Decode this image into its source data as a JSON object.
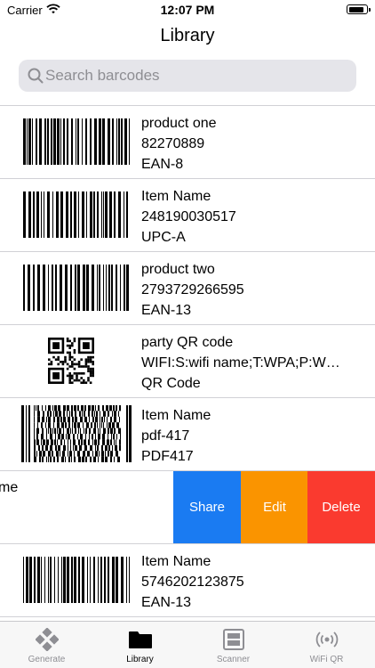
{
  "status_bar": {
    "carrier": "Carrier",
    "time": "12:07 PM",
    "battery_level": 0.9
  },
  "nav": {
    "title": "Library"
  },
  "search": {
    "placeholder": "Search barcodes",
    "value": ""
  },
  "items": [
    {
      "title": "product one",
      "value": "82270889",
      "type": "EAN-8",
      "thumb": "linear-barcode"
    },
    {
      "title": "Item Name",
      "value": "248190030517",
      "type": "UPC-A",
      "thumb": "linear-barcode"
    },
    {
      "title": "product two",
      "value": "2793729266595",
      "type": "EAN-13",
      "thumb": "linear-barcode"
    },
    {
      "title": "party QR code",
      "value": "WIFI:S:wifi name;T:WPA;P:W…",
      "type": "QR Code",
      "thumb": "qr-code"
    },
    {
      "title": "Item Name",
      "value": "pdf-417",
      "type": "PDF417",
      "thumb": "pdf417-code"
    }
  ],
  "swiped_row": {
    "partial_title": "me",
    "actions": {
      "share": "Share",
      "edit": "Edit",
      "delete": "Delete"
    },
    "colors": {
      "share": "#1a7bf2",
      "edit": "#fa9400",
      "delete": "#fa3a2f"
    }
  },
  "items_after": [
    {
      "title": "Item Name",
      "value": "5746202123875",
      "type": "EAN-13",
      "thumb": "linear-barcode"
    }
  ],
  "tabs": [
    {
      "label": "Generate",
      "icon": "generate-icon",
      "active": false
    },
    {
      "label": "Library",
      "icon": "folder-icon",
      "active": true
    },
    {
      "label": "Scanner",
      "icon": "scanner-icon",
      "active": false
    },
    {
      "label": "WiFi QR",
      "icon": "wifi-qr-icon",
      "active": false
    }
  ]
}
